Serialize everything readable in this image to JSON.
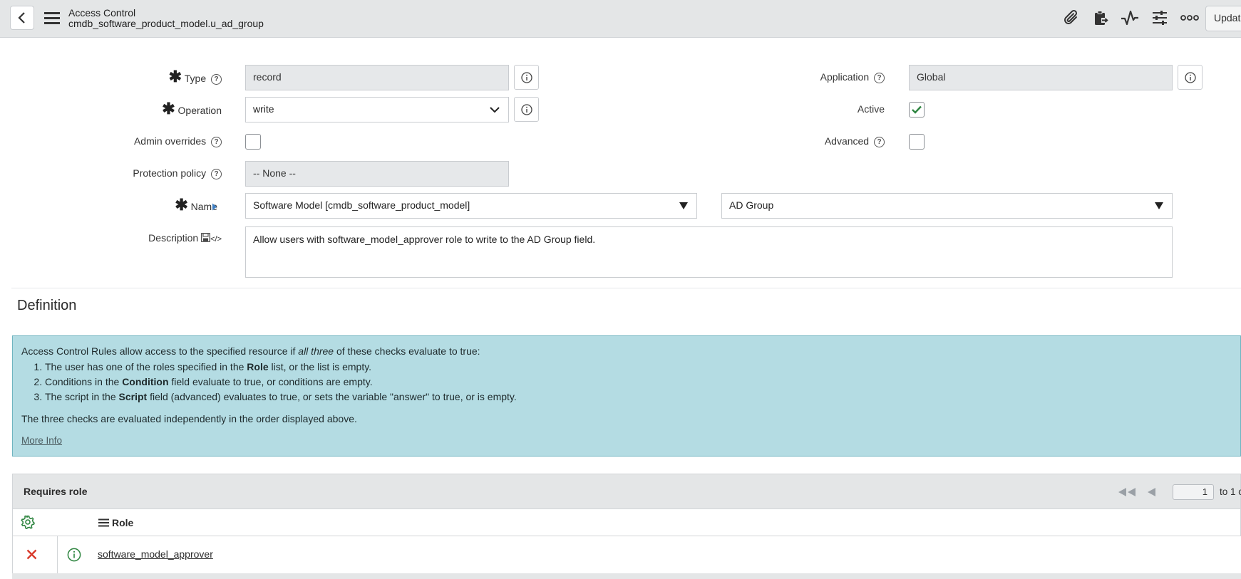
{
  "header": {
    "title": "Access Control",
    "subtitle": "cmdb_software_product_model.u_ad_group",
    "update_label": "Updat",
    "toolbar_icons": [
      "paperclip-icon",
      "clipboard-icon",
      "activity-icon",
      "sliders-icon",
      "more-icon"
    ]
  },
  "form": {
    "type": {
      "label": "Type",
      "value": "record"
    },
    "operation": {
      "label": "Operation",
      "value": "write"
    },
    "admin_overrides": {
      "label": "Admin overrides",
      "checked": false
    },
    "protection_policy": {
      "label": "Protection policy",
      "value": "-- None --"
    },
    "name": {
      "label": "Name",
      "table_value": "Software Model [cmdb_software_product_model]",
      "field_value": "AD Group"
    },
    "description": {
      "label": "Description",
      "value": "Allow users with software_model_approver role to write to the AD Group field."
    },
    "application": {
      "label": "Application",
      "value": "Global"
    },
    "active": {
      "label": "Active",
      "checked": true
    },
    "advanced": {
      "label": "Advanced",
      "checked": false
    }
  },
  "definition": {
    "title": "Definition",
    "intro_prefix": "Access Control Rules allow access to the specified resource if ",
    "intro_em": "all three",
    "intro_suffix": " of these checks evaluate to true:",
    "items": [
      {
        "prefix": "The user has one of the roles specified in the ",
        "bold": "Role",
        "suffix": " list, or the list is empty."
      },
      {
        "prefix": "Conditions in the ",
        "bold": "Condition",
        "suffix": " field evaluate to true, or conditions are empty."
      },
      {
        "prefix": "The script in the ",
        "bold": "Script",
        "suffix": " field (advanced) evaluates to true, or sets the variable \"answer\" to true, or is empty."
      }
    ],
    "note": "The three checks are evaluated independently in the order displayed above.",
    "more_info": "More Info"
  },
  "related_list": {
    "title": "Requires role",
    "page_value": "1",
    "page_suffix": "to 1 o",
    "column_role": "Role",
    "rows": [
      {
        "role": "software_model_approver"
      }
    ]
  },
  "colors": {
    "accent": "#2e8540",
    "delete": "#d93a2b",
    "info_bg": "#b4dce3"
  }
}
